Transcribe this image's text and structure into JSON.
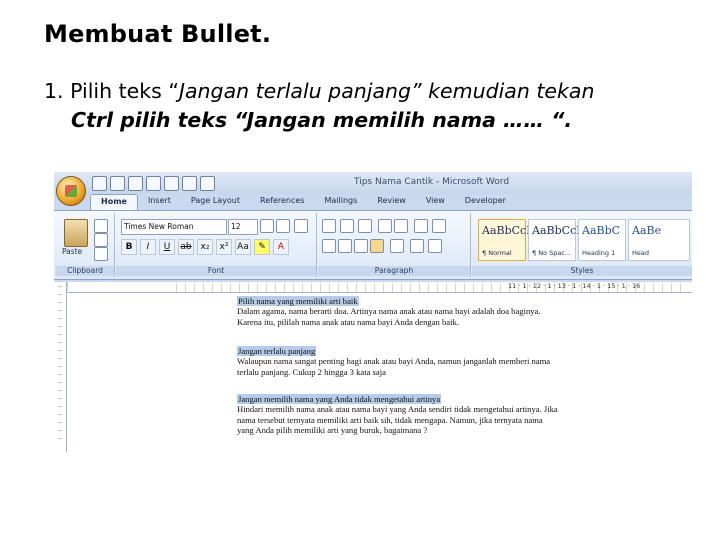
{
  "slide": {
    "title": "Membuat Bullet.",
    "step_number": "1.",
    "step_line1_a": "Pilih teks “",
    "step_line1_italic": "Jangan terlalu panjang” kemudian tekan",
    "step_line2": "Ctrl pilih teks “Jangan memilih nama …… “."
  },
  "word": {
    "window_title": "Tips Nama Cantik - Microsoft Word",
    "tabs": [
      {
        "label": "Home"
      },
      {
        "label": "Insert"
      },
      {
        "label": "Page Layout"
      },
      {
        "label": "References"
      },
      {
        "label": "Mailings"
      },
      {
        "label": "Review"
      },
      {
        "label": "View"
      },
      {
        "label": "Developer"
      }
    ],
    "groups": {
      "clipboard": "Clipboard",
      "paste": "Paste",
      "font": "Font",
      "paragraph": "Paragraph",
      "styles": "Styles"
    },
    "font_name": "Times New Roman",
    "font_size": "12",
    "styles": [
      {
        "preview": "AaBbCcI",
        "name": "¶ Normal"
      },
      {
        "preview": "AaBbCcI",
        "name": "¶ No Spac..."
      },
      {
        "preview": "AaBbC",
        "name": "Heading 1"
      },
      {
        "preview": "AaBe",
        "name": "Head"
      }
    ],
    "ruler_numbers": "11 · 1 · 12 · 1 · 13 · 1 · 14 · 1 · 15 · 1 · 16",
    "document": {
      "p1_heading": "Pilih nama yang memiliki arti baik",
      "p1_line1": "Dalam agama, nama berarti doa. Artinya nama anak atau nama bayi adalah doa baginya.",
      "p1_line2": "Karena itu, pililah nama anak atau nama bayi Anda dengan baik.",
      "p2_heading": "Jangan terlalu panjang",
      "p2_line1": "Walaupun nama sangat penting bagi anak atau bayi Anda, namun janganlah memberi nama",
      "p2_line2": "terlalu panjang. Cukup 2 hingga 3 kata saja",
      "p3_heading": "Jangan memilih nama yang Anda tidak mengetahui artinya",
      "p3_line1": "Hindari memilih nama anak atau nama bayi yang Anda sendiri tidak mengetahui artinya. Jika",
      "p3_line2": "nama tersebut ternyata memiliki arti baik sih, tidak mengapa. Namun, jika ternyata nama",
      "p3_line3": "yang Anda pilih memiliki arti yang buruk, bagaimana ?"
    }
  }
}
